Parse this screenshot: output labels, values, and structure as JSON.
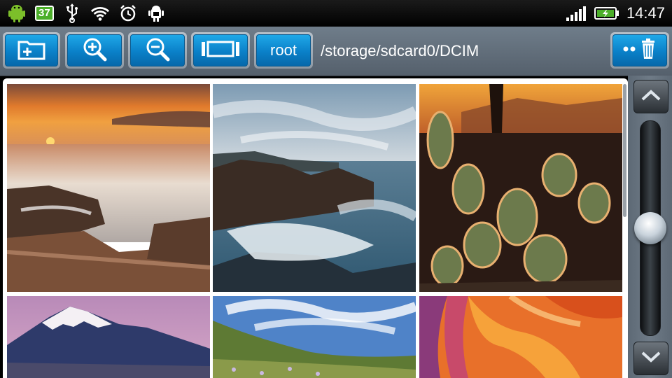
{
  "status_bar": {
    "left_icons": [
      "android-icon",
      "usb-icon",
      "wifi-icon",
      "alarm-icon",
      "android-debug-icon"
    ],
    "notification_badge": "37",
    "right_icons": [
      "signal-icon",
      "battery-icon"
    ],
    "time": "14:47"
  },
  "toolbar": {
    "buttons": [
      "new-folder-icon",
      "zoom-in-icon",
      "zoom-out-icon",
      "fit-view-icon"
    ],
    "root_label": "root",
    "path": "/storage/sdcard0/DCIM",
    "menu_button_icon": "menu-trash-icon"
  },
  "gallery": {
    "thumbnails": [
      {
        "subject": "sunset-over-rocky-shore"
      },
      {
        "subject": "waves-crashing-on-rocks"
      },
      {
        "subject": "backlit-cholla-cacti"
      },
      {
        "subject": "snowy-mountain-at-dusk"
      },
      {
        "subject": "green-hills-under-clouds"
      },
      {
        "subject": "orange-slot-canyon"
      }
    ]
  },
  "colors": {
    "toolbar_button": "#0a80c8",
    "toolbar_bg": "#6f7d8a",
    "status_bg": "#000000",
    "battery_green": "#4caf2a"
  }
}
